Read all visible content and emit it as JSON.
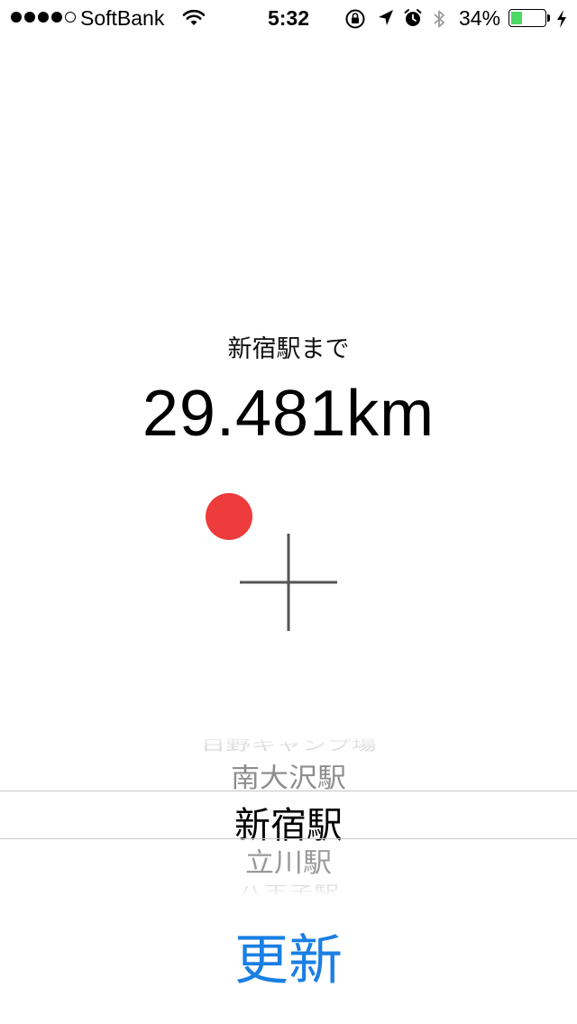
{
  "status_bar": {
    "carrier": "SoftBank",
    "time": "5:32",
    "battery_percent_text": "34%",
    "battery_level": 0.34,
    "signal_bars_filled": 4,
    "signal_bars_total": 5,
    "icons": [
      "wifi-icon",
      "orientation-lock-icon",
      "location-arrow-icon",
      "alarm-icon",
      "bluetooth-icon",
      "charging-bolt-icon"
    ],
    "battery_color": "#4cd964"
  },
  "main": {
    "destination_label": "新宿駅まで",
    "distance": "29.481km",
    "direction_indicator": {
      "dot_color": "#ee3b3b",
      "crosshair_color": "#555555"
    }
  },
  "picker": {
    "rows": [
      "日野キャンプ場",
      "南大沢駅",
      "新宿駅",
      "立川駅",
      "八王子駅"
    ],
    "selected": "新宿駅"
  },
  "update_button": {
    "label": "更新",
    "color": "#1a7fe3"
  }
}
